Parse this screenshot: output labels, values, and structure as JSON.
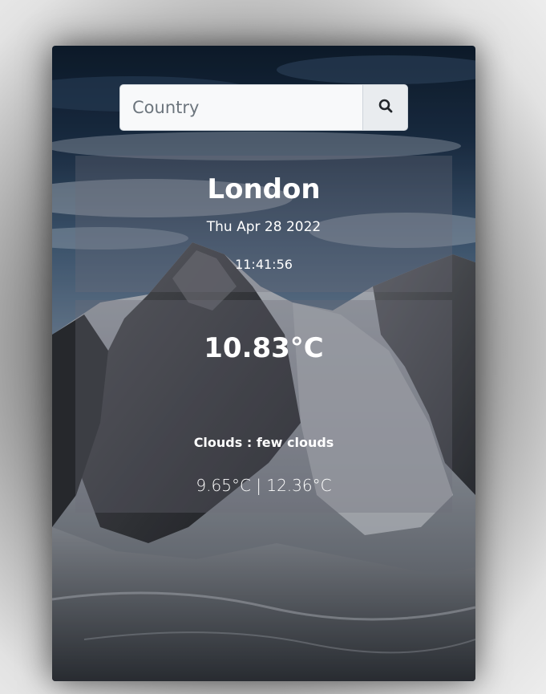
{
  "search": {
    "placeholder": "Country",
    "icon": "search-icon"
  },
  "location": {
    "city": "London",
    "date": "Thu Apr 28 2022",
    "time": "11:41:56"
  },
  "weather": {
    "temperature": "10.83°C",
    "clouds": "Clouds : few clouds",
    "range": "9.65°C | 12.36°C"
  }
}
